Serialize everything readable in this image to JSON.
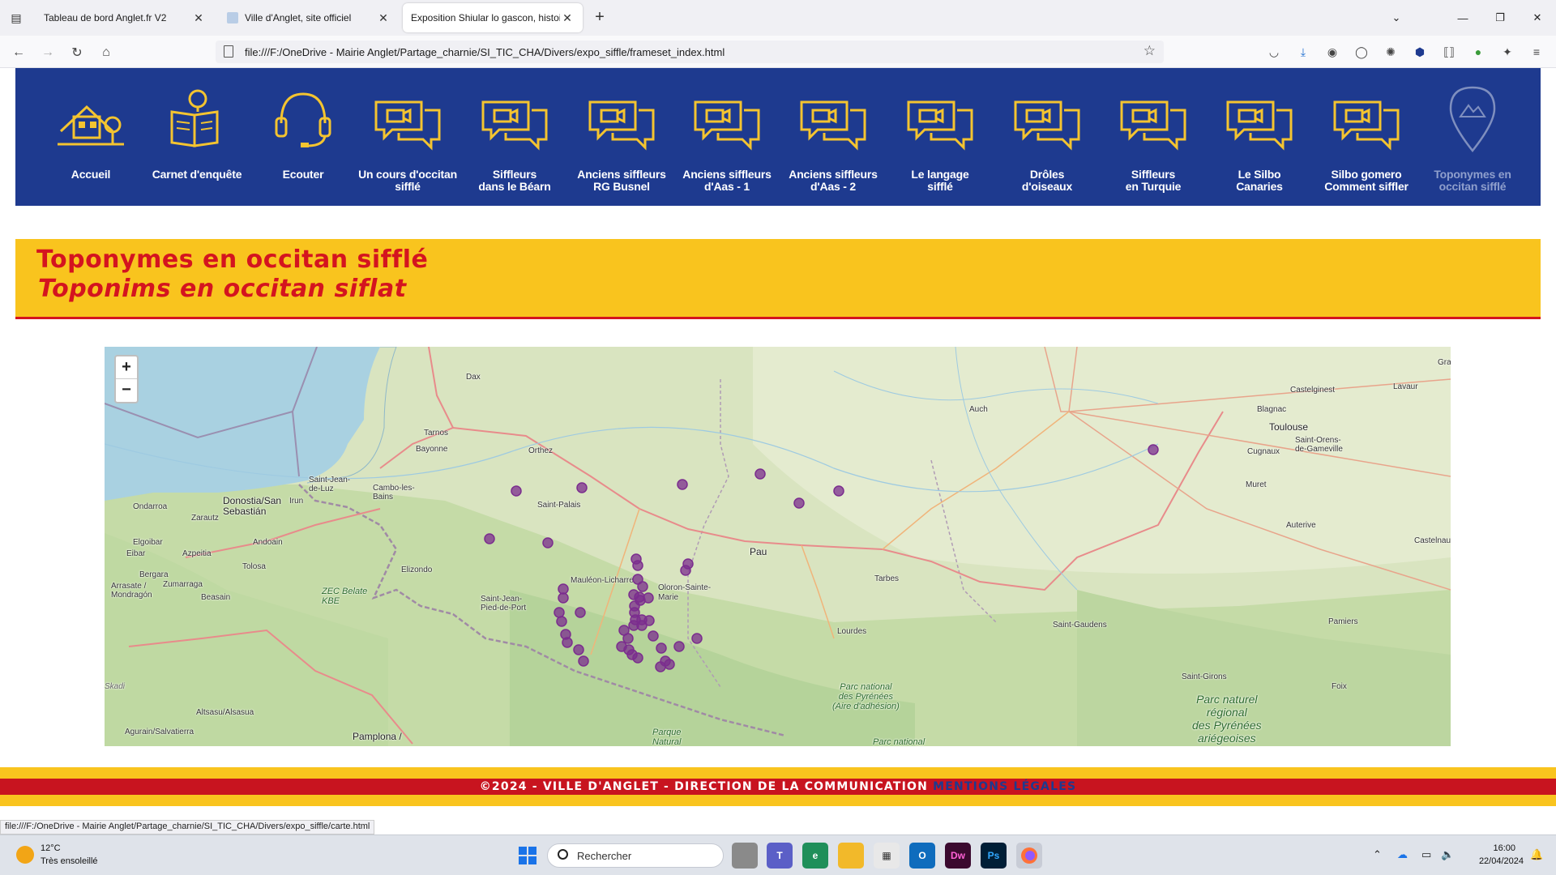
{
  "browser": {
    "tabs": [
      {
        "title": "Tableau de bord Anglet.fr V2",
        "active": false
      },
      {
        "title": "Ville d'Anglet, site officiel",
        "active": false
      },
      {
        "title": "Exposition Shiular lo gascon, histoire",
        "active": true
      }
    ],
    "url": "file:///F:/OneDrive - Mairie Anglet/Partage_charnie/SI_TIC_CHA/Divers/expo_siffle/frameset_index.html",
    "status_url": "file:///F:/OneDrive - Mairie Anglet/Partage_charnie/SI_TIC_CHA/Divers/expo_siffle/carte.html"
  },
  "nav": {
    "items": [
      {
        "label": "Accueil",
        "icon": "house-tree-icon"
      },
      {
        "label": "Carnet d'enquête",
        "icon": "book-lightbulb-icon"
      },
      {
        "label": "Ecouter",
        "icon": "headset-icon"
      },
      {
        "label": "Un cours d'occitan\nsifflé",
        "icon": "video-chat-icon"
      },
      {
        "label": "Siffleurs\ndans le Béarn",
        "icon": "video-chat-icon"
      },
      {
        "label": "Anciens siffleurs\nRG Busnel",
        "icon": "video-chat-icon"
      },
      {
        "label": "Anciens siffleurs\nd'Aas - 1",
        "icon": "video-chat-icon"
      },
      {
        "label": "Anciens siffleurs\nd'Aas - 2",
        "icon": "video-chat-icon"
      },
      {
        "label": "Le langage\nsifflé",
        "icon": "video-chat-icon"
      },
      {
        "label": "Drôles\nd'oiseaux",
        "icon": "video-chat-icon"
      },
      {
        "label": "Siffleurs\nen Turquie",
        "icon": "video-chat-icon"
      },
      {
        "label": "Le Silbo\nCanaries",
        "icon": "video-chat-icon"
      },
      {
        "label": "Silbo gomero\nComment siffler",
        "icon": "video-chat-icon"
      },
      {
        "label": "Toponymes en\noccitan sifflé",
        "icon": "map-pin-mountain-icon",
        "dimmed": true
      }
    ]
  },
  "banner": {
    "title_fr": "Toponymes en occitan sifflé",
    "title_oc": "Toponims en occitan siflat"
  },
  "map": {
    "zoom_in": "+",
    "zoom_out": "−",
    "places": [
      "Dax",
      "Tarnos",
      "Bayonne",
      "Orthez",
      "Saint-Jean-\nde-Luz",
      "Cambo-les-\nBains",
      "Donostia/San\nSebastián",
      "Irun",
      "Zarautz",
      "Ondarroa",
      "Elgoibar",
      "Eibar",
      "Azpeitia",
      "Andoain",
      "Tolosa",
      "Bergara",
      "Zumarraga",
      "Arrasate /\nMondragón",
      "Beasain",
      "Elizondo",
      "ZEC Belate\nKBE",
      "Saint-Palais",
      "Mauléon-Licharre",
      "Oloron-Sainte-\nMarie",
      "Saint-Jean-\nPied-de-Port",
      "Pau",
      "Tarbes",
      "Lourdes",
      "Auch",
      "Toulouse",
      "Castelginest",
      "Blagnac",
      "Saint-Orens-\nde-Gameville",
      "Cugnaux",
      "Muret",
      "Lavaur",
      "Auterive",
      "Castelnau",
      "Saint-Gaudens",
      "Pamiers",
      "Saint-Girons",
      "Foix",
      "Altsasu/Alsasua",
      "Agurain/Salvatierra",
      "Pamplona /",
      "Parc national\ndes Pyrénées\n(Aire d'adhésion)",
      "Parc naturel\nrégional\ndes Pyrénées\nariégeoises",
      "Parque\nNatural",
      "Parc national",
      "Skadi",
      "Gra"
    ],
    "marker_color": "#7b2d8e",
    "marker_count": 48
  },
  "footer": {
    "text": "©2024 - VILLE D'ANGLET - DIRECTION DE LA COMMUNICATION",
    "legal": "MENTIONS LÉGALES"
  },
  "taskbar": {
    "temp": "12°C",
    "weather": "Très ensoleillé",
    "search": "Rechercher",
    "time": "16:00",
    "date": "22/04/2024"
  }
}
